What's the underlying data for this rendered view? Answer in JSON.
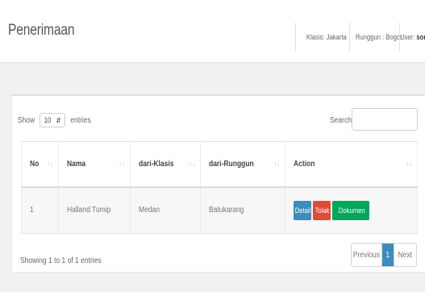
{
  "header": {
    "title": "Penerimaan",
    "klasis": "Klasis: Jakarta",
    "runggun": "Runggun : Bogor",
    "user_label": "User:",
    "user_name": "sontri"
  },
  "controls": {
    "show_label": "Show",
    "entries_value": "10",
    "entries_label": "entries",
    "search_label": "Search:"
  },
  "table": {
    "columns": [
      "No",
      "Nama",
      "dari-Klasis",
      "dari-Runggun",
      "Action"
    ],
    "rows": [
      {
        "no": "1",
        "nama": "Halland Tumip",
        "klasis": "Medan",
        "runggun": "Batukarang"
      }
    ],
    "actions": {
      "detail": "Detail",
      "tolak": "Tolak",
      "dokumen": "Dokumen"
    }
  },
  "footer": {
    "info": "Showing 1 to 1 of 1 entries",
    "previous": "Previous",
    "page": "1",
    "next": "Next"
  },
  "colors": {
    "primary": "#3c8dbc",
    "danger": "#dd4b39",
    "success": "#00a65a"
  }
}
